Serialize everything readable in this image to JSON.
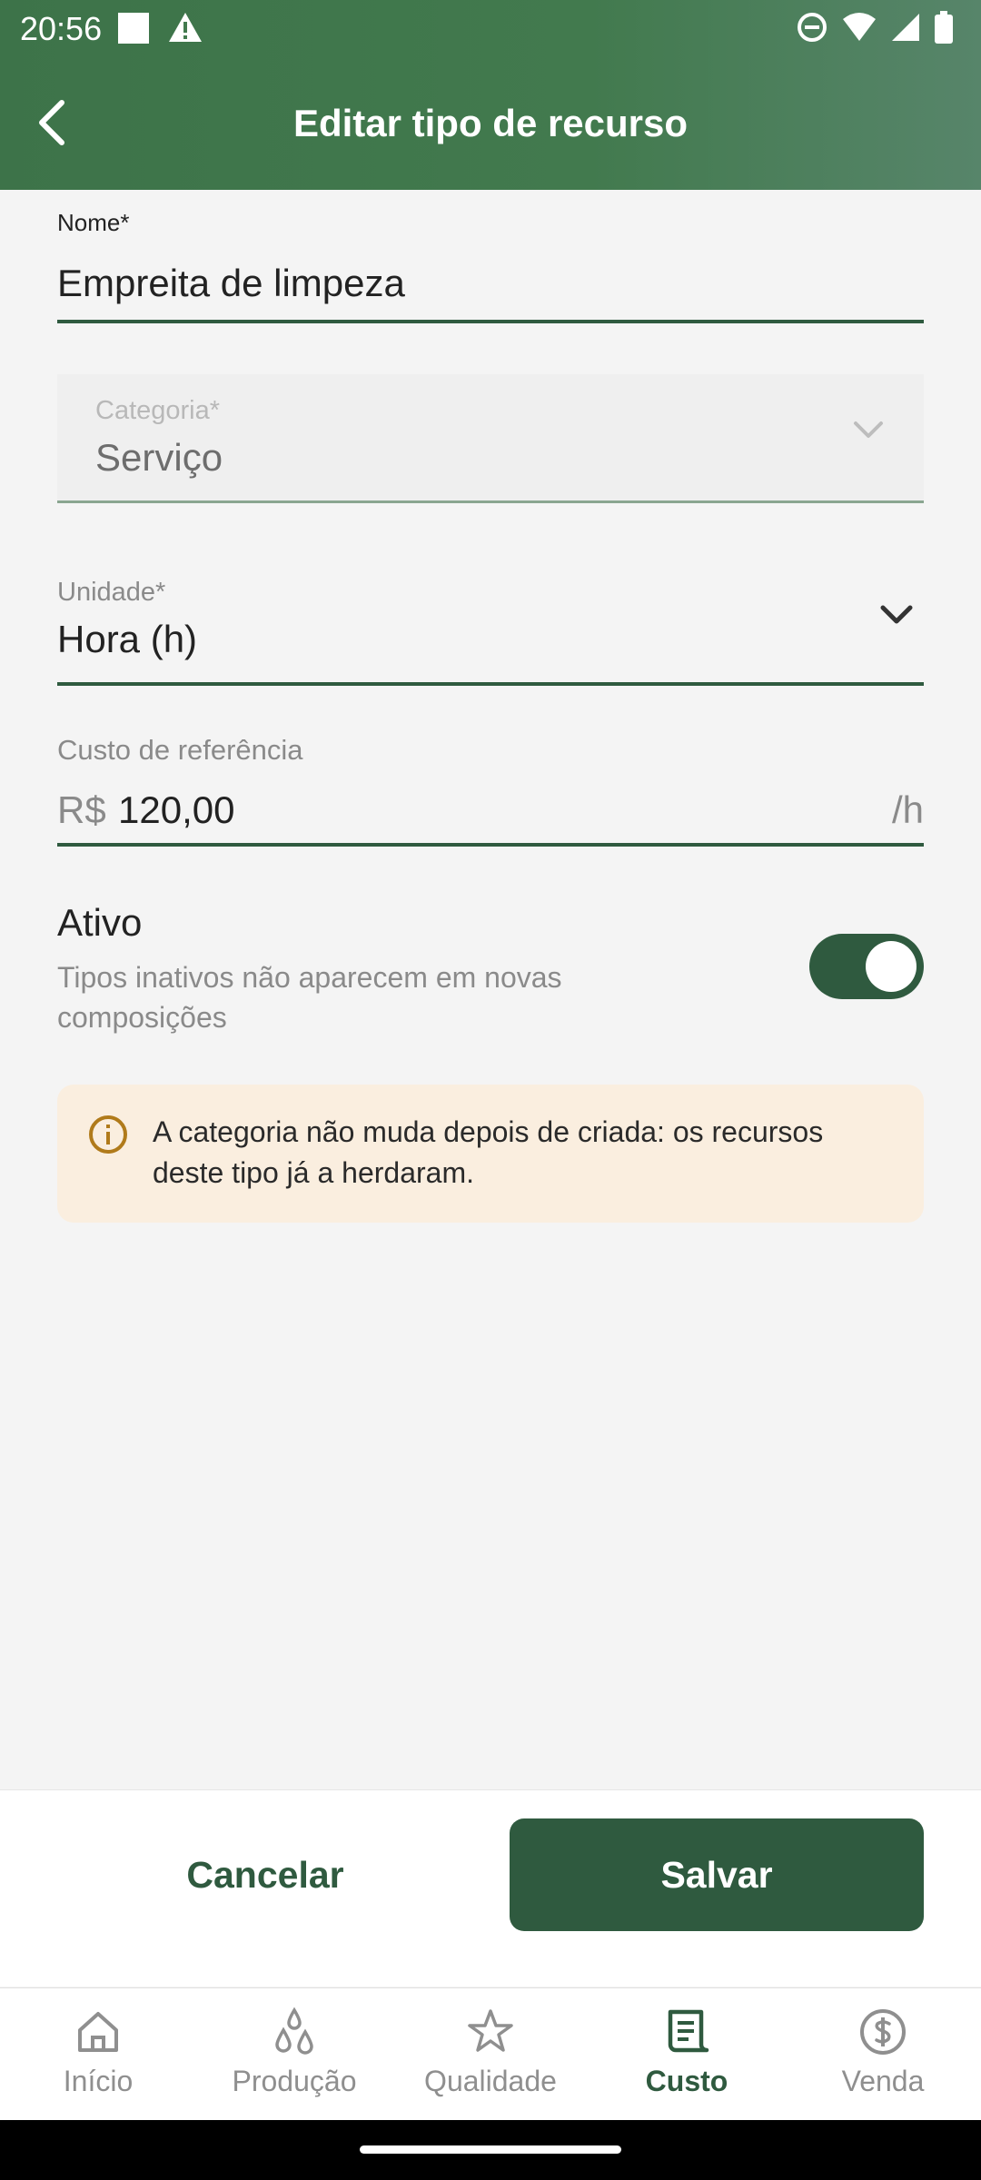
{
  "status_bar": {
    "time": "20:56"
  },
  "header": {
    "title": "Editar tipo de recurso"
  },
  "form": {
    "name": {
      "label": "Nome*",
      "value": "Empreita de limpeza"
    },
    "category": {
      "label": "Categoria*",
      "value": "Serviço"
    },
    "unit": {
      "label": "Unidade*",
      "value": "Hora (h)"
    },
    "cost": {
      "label": "Custo de referência",
      "prefix": "R$",
      "value": "120,00",
      "suffix": "/h"
    },
    "active": {
      "title": "Ativo",
      "description": "Tipos inativos não aparecem em novas composições",
      "enabled": true
    }
  },
  "info": {
    "text": "A categoria não muda depois de criada: os recursos deste tipo já a herdaram."
  },
  "actions": {
    "cancel": "Cancelar",
    "save": "Salvar"
  },
  "nav": {
    "items": [
      {
        "label": "Início",
        "icon": "home-icon"
      },
      {
        "label": "Produção",
        "icon": "drops-icon"
      },
      {
        "label": "Qualidade",
        "icon": "star-icon"
      },
      {
        "label": "Custo",
        "icon": "receipt-icon",
        "active": true
      },
      {
        "label": "Venda",
        "icon": "dollar-icon"
      }
    ]
  },
  "colors": {
    "primary": "#2f5a3f",
    "header": "#427a4e",
    "info_bg": "#faeedf",
    "info_icon": "#b07a1a"
  }
}
